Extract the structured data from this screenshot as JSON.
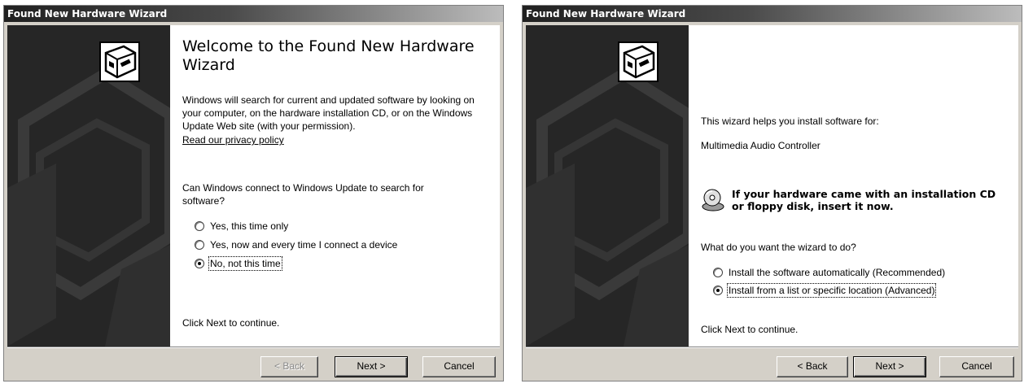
{
  "window1": {
    "title": "Found New Hardware Wizard",
    "heading": "Welcome to the Found New Hardware Wizard",
    "intro": "Windows will search for current and updated software by looking on your computer, on the hardware installation CD, or on the Windows Update Web site (with your permission).",
    "privacy_link": "Read our privacy policy",
    "question": "Can Windows connect to Windows Update to search for software?",
    "options": [
      {
        "label": "Yes, this time only",
        "selected": false
      },
      {
        "label": "Yes, now and every time I connect a device",
        "selected": false
      },
      {
        "label": "No, not this time",
        "selected": true
      }
    ],
    "footer_text": "Click Next to continue.",
    "buttons": {
      "back": "< Back",
      "next": "Next >",
      "cancel": "Cancel"
    }
  },
  "window2": {
    "title": "Found New Hardware Wizard",
    "helps_text": "This wizard helps you install software for:",
    "device_name": "Multimedia Audio Controller",
    "cd_prompt": "If your hardware came with an installation CD or floppy disk, insert it now.",
    "question": "What do you want the wizard to do?",
    "options": [
      {
        "label": "Install the software automatically (Recommended)",
        "selected": false
      },
      {
        "label": "Install from a list or specific location (Advanced)",
        "selected": true
      }
    ],
    "footer_text": "Click Next to continue.",
    "buttons": {
      "back": "< Back",
      "next": "Next >",
      "cancel": "Cancel"
    }
  }
}
